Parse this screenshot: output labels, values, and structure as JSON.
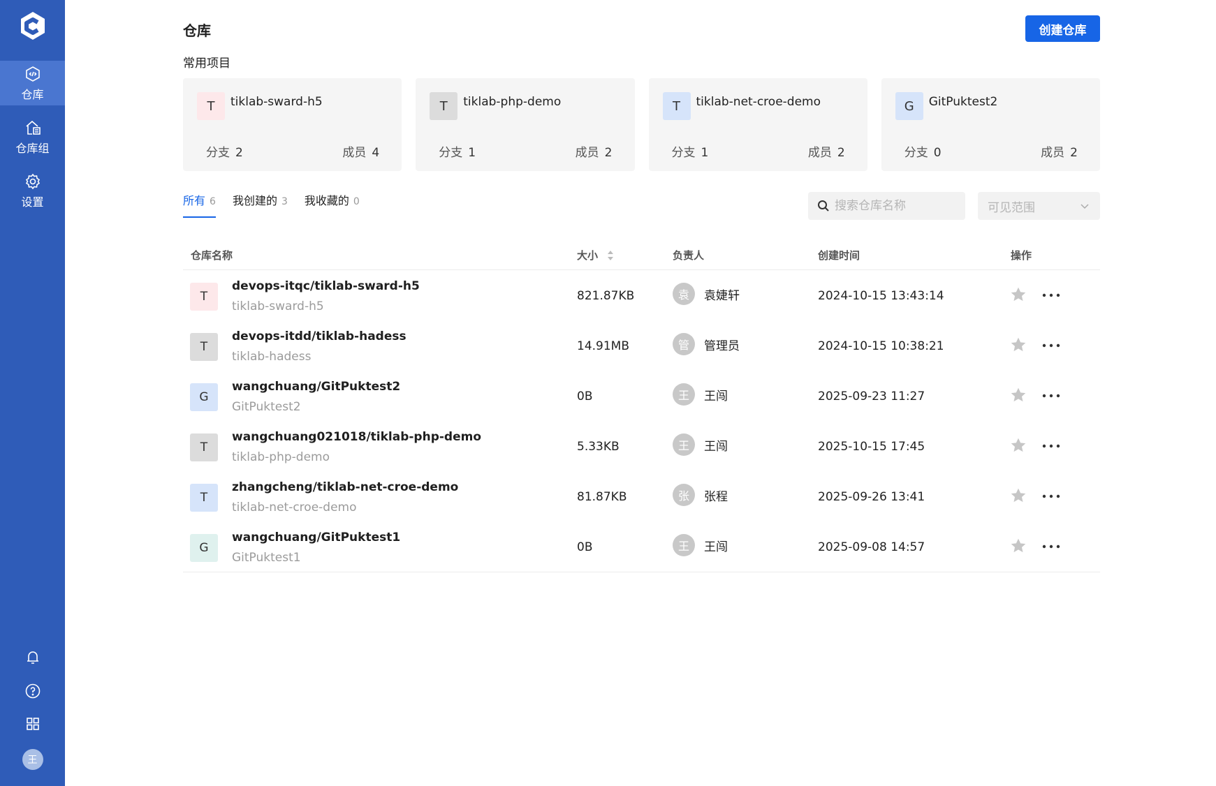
{
  "sidebar": {
    "nav": [
      {
        "label": "仓库",
        "icon": "code-repo-icon",
        "active": true
      },
      {
        "label": "仓库组",
        "icon": "repo-group-icon",
        "active": false
      },
      {
        "label": "设置",
        "icon": "gear-icon",
        "active": false
      }
    ],
    "bottom_icons": [
      "bell-icon",
      "help-icon",
      "apps-grid-icon"
    ],
    "avatar": "王"
  },
  "header": {
    "title": "仓库",
    "create_label": "创建仓库"
  },
  "favorites": {
    "label": "常用项目",
    "branch_label": "分支",
    "member_label": "成员",
    "items": [
      {
        "initial": "T",
        "name": "tiklab-sward-h5",
        "branches": "2",
        "members": "4",
        "color": "#fde8ea"
      },
      {
        "initial": "T",
        "name": "tiklab-php-demo",
        "branches": "1",
        "members": "2",
        "color": "#dcdcdc"
      },
      {
        "initial": "T",
        "name": "tiklab-net-croe-demo",
        "branches": "1",
        "members": "2",
        "color": "#d6e4fa"
      },
      {
        "initial": "G",
        "name": "GitPuktest2",
        "branches": "0",
        "members": "2",
        "color": "#d6e4fa"
      }
    ]
  },
  "tabs": [
    {
      "label": "所有",
      "count": "6",
      "active": true
    },
    {
      "label": "我创建的",
      "count": "3",
      "active": false
    },
    {
      "label": "我收藏的",
      "count": "0",
      "active": false
    }
  ],
  "filters": {
    "search_placeholder": "搜索仓库名称",
    "visibility_placeholder": "可见范围"
  },
  "table": {
    "columns": {
      "name": "仓库名称",
      "size": "大小",
      "owner": "负责人",
      "time": "创建时间",
      "op": "操作"
    },
    "rows": [
      {
        "initial": "T",
        "color": "#fde8ea",
        "full": "devops-itqc/tiklab-sward-h5",
        "short": "tiklab-sward-h5",
        "size": "821.87KB",
        "owner_initial": "袁",
        "owner": "袁婕轩",
        "time": "2024-10-15 13:43:14"
      },
      {
        "initial": "T",
        "color": "#dcdcdc",
        "full": "devops-itdd/tiklab-hadess",
        "short": "tiklab-hadess",
        "size": "14.91MB",
        "owner_initial": "管",
        "owner": "管理员",
        "time": "2024-10-15 10:38:21"
      },
      {
        "initial": "G",
        "color": "#d6e4fa",
        "full": "wangchuang/GitPuktest2",
        "short": "GitPuktest2",
        "size": "0B",
        "owner_initial": "王",
        "owner": "王闯",
        "time": "2025-09-23 11:27"
      },
      {
        "initial": "T",
        "color": "#dcdcdc",
        "full": "wangchuang021018/tiklab-php-demo",
        "short": "tiklab-php-demo",
        "size": "5.33KB",
        "owner_initial": "王",
        "owner": "王闯",
        "time": "2025-10-15 17:45"
      },
      {
        "initial": "T",
        "color": "#d6e4fa",
        "full": "zhangcheng/tiklab-net-croe-demo",
        "short": "tiklab-net-croe-demo",
        "size": "81.87KB",
        "owner_initial": "张",
        "owner": "张程",
        "time": "2025-09-26 13:41"
      },
      {
        "initial": "G",
        "color": "#dff1ee",
        "full": "wangchuang/GitPuktest1",
        "short": "GitPuktest1",
        "size": "0B",
        "owner_initial": "王",
        "owner": "王闯",
        "time": "2025-09-08 14:57"
      }
    ]
  },
  "colors": {
    "sidebar": "#2f5cb8",
    "sidebar_active": "#4a76d0",
    "accent": "#1765e6"
  }
}
